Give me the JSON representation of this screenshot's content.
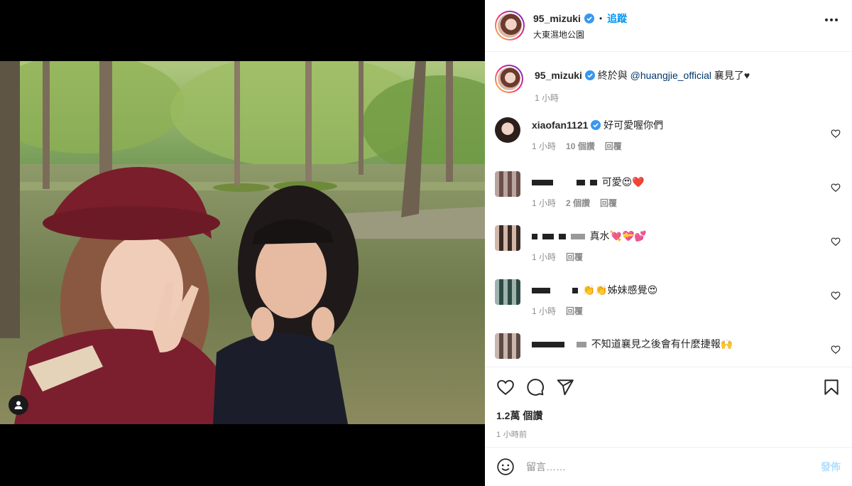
{
  "post": {
    "username": "95_mizuki",
    "follow_label": "追蹤",
    "dot": "•",
    "location": "大東濕地公園",
    "caption_prefix": "終於與 ",
    "caption_mention": "@huangjie_official",
    "caption_suffix": " 襄見了",
    "caption_heart": "♥",
    "caption_time": "1 小時"
  },
  "comments": [
    {
      "username": "xiaofan1121",
      "verified": true,
      "text": "好可愛喔你們",
      "time": "1 小時",
      "likes": "10 個讚",
      "reply": "回覆"
    },
    {
      "username": "",
      "text": "可愛😍❤️",
      "time": "1 小時",
      "likes": "2 個讚",
      "reply": "回覆"
    },
    {
      "username": "",
      "text": "真水💘💝💕",
      "time": "1 小時",
      "likes": "",
      "reply": "回覆"
    },
    {
      "username": "",
      "text": "👏👏姊妹感覺😍",
      "time": "1 小時",
      "likes": "",
      "reply": "回覆"
    },
    {
      "username": "",
      "text": "不知道襄見之後會有什麼捷報🙌",
      "time": "",
      "likes": "",
      "reply": ""
    }
  ],
  "actions": {
    "icons": [
      "heart-icon",
      "comment-icon",
      "share-icon",
      "bookmark-icon"
    ],
    "likes_count": "1.2萬 個讚",
    "posted_ago": "1 小時前"
  },
  "composer": {
    "placeholder": "留言……",
    "post_label": "發佈"
  },
  "colors": {
    "accent": "#0095f6",
    "verified": "#3897f0",
    "post_disabled": "#b2dffc"
  }
}
